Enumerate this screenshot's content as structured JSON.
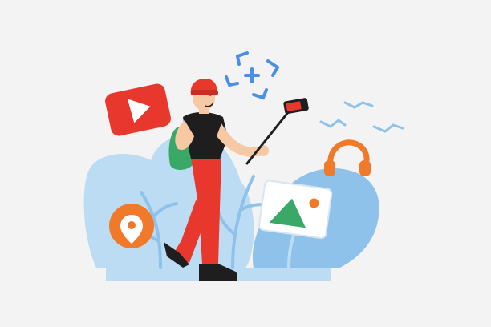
{
  "scene": {
    "background_color": "#f3f3f3",
    "elements": [
      "ground-bar",
      "foliage-left",
      "foliage-right",
      "play-button-icon",
      "location-pin-icon",
      "image-card-icon",
      "headphones-icon",
      "camera-focus-icon",
      "birds-group",
      "traveler-character",
      "selfie-stick",
      "smartphone"
    ]
  },
  "colors": {
    "red": "#e8382e",
    "orange": "#f07a2a",
    "light_blue": "#bcdcf4",
    "mid_blue": "#8ec2ea",
    "focus_blue": "#4a8fe6",
    "green": "#3aa866",
    "black": "#1e1e1e",
    "skin": "#f6c8a4"
  }
}
